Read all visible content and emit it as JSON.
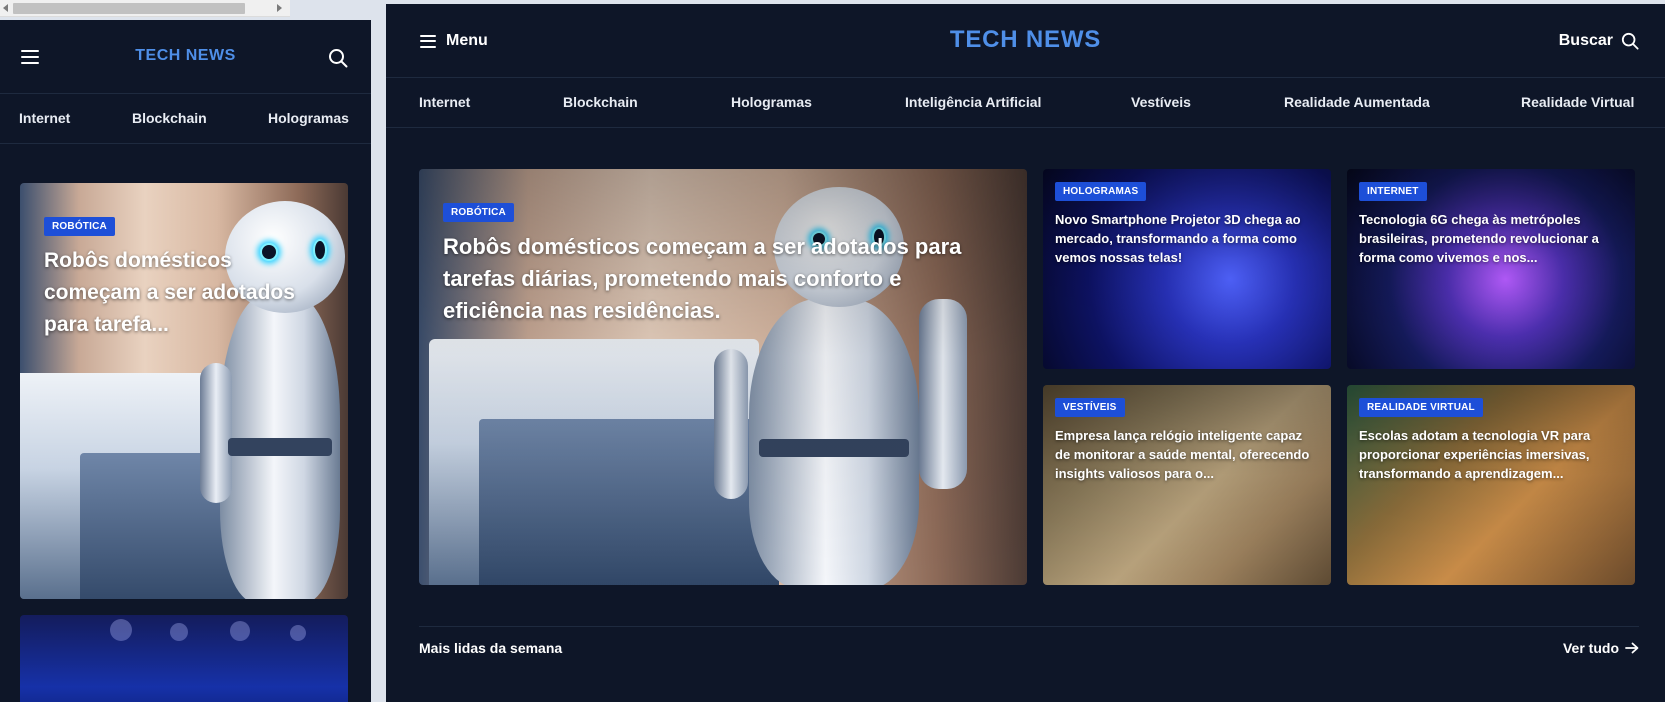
{
  "brand": {
    "logo": "TECH NEWS",
    "accent_color": "#4f8fe8",
    "badge_color": "#1d4fd8",
    "bg_color": "#0e1628"
  },
  "header": {
    "menu_label": "Menu",
    "search_label": "Buscar"
  },
  "nav": {
    "items": [
      "Internet",
      "Blockchain",
      "Hologramas",
      "Inteligência Artificial",
      "Vestíveis",
      "Realidade Aumentada",
      "Realidade Virtual"
    ]
  },
  "mobile": {
    "nav_items": [
      "Internet",
      "Blockchain",
      "Hologramas"
    ],
    "featured": {
      "badge": "ROBÓTICA",
      "title": "Robôs domésticos começam a ser adotados para tarefa..."
    }
  },
  "featured": {
    "badge": "ROBÓTICA",
    "title": "Robôs domésticos começam a ser adotados para tarefas diárias, prometendo mais conforto e eficiência nas residências."
  },
  "cards": [
    {
      "badge": "HOLOGRAMAS",
      "title": "Novo Smartphone Projetor 3D chega ao mercado, transformando a forma como vemos nossas telas!"
    },
    {
      "badge": "INTERNET",
      "title": "Tecnologia 6G chega às metrópoles brasileiras, prometendo revolucionar a forma como vivemos e nos..."
    },
    {
      "badge": "VESTÍVEIS",
      "title": "Empresa lança relógio inteligente capaz de monitorar a saúde mental, oferecendo insights valiosos para o..."
    },
    {
      "badge": "REALIDADE VIRTUAL",
      "title": "Escolas adotam a tecnologia VR para proporcionar experiências imersivas, transformando a aprendizagem..."
    }
  ],
  "section": {
    "title": "Mais lidas da semana",
    "see_all": "Ver tudo"
  },
  "icons": {
    "menu": "hamburger-icon",
    "search": "search-icon",
    "arrow": "arrow-right-icon"
  }
}
